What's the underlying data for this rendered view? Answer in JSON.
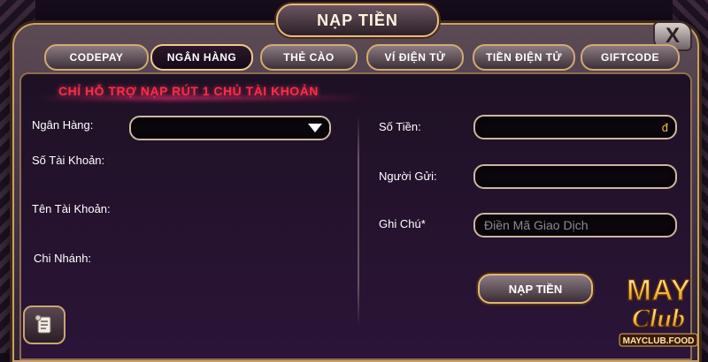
{
  "dialog": {
    "title": "NẠP TIỀN",
    "close_label": "X"
  },
  "tabs": [
    {
      "label": "CODEPAY",
      "active": false
    },
    {
      "label": "NGÂN HÀNG",
      "active": true
    },
    {
      "label": "THẺ CÀO",
      "active": false
    },
    {
      "label": "VÍ ĐIỆN TỬ",
      "active": false
    },
    {
      "label": "TIỀN ĐIỆN TỬ",
      "active": false
    },
    {
      "label": "GIFTCODE",
      "active": false
    }
  ],
  "notice": "CHỈ HỖ TRỢ NẠP RÚT 1 CHỦ TÀI KHOẢN",
  "left_form": {
    "bank_label": "Ngân Hàng:",
    "bank_value": "",
    "account_number_label": "Số Tài Khoản:",
    "account_name_label": "Tên Tài Khoản:",
    "branch_label": "Chi Nhánh:"
  },
  "right_form": {
    "amount_label": "Số Tiền:",
    "amount_value": "",
    "currency_symbol": "đ",
    "sender_label": "Người Gửi:",
    "sender_value": "",
    "note_label": "Ghi Chú*",
    "note_placeholder": "Điền Mã Giao Dịch"
  },
  "submit_label": "NẠP TIỀN",
  "logo": {
    "word1": "MAY",
    "word2": "Club",
    "domain": "MAYCLUB.FOOD"
  },
  "icons": {
    "close": "close-icon",
    "history": "scroll-history-icon",
    "dropdown": "chevron-down-icon"
  },
  "colors": {
    "accent_gold": "#e0b77a",
    "notice_red": "#ff2a4a",
    "currency_gold": "#e8b84a"
  }
}
